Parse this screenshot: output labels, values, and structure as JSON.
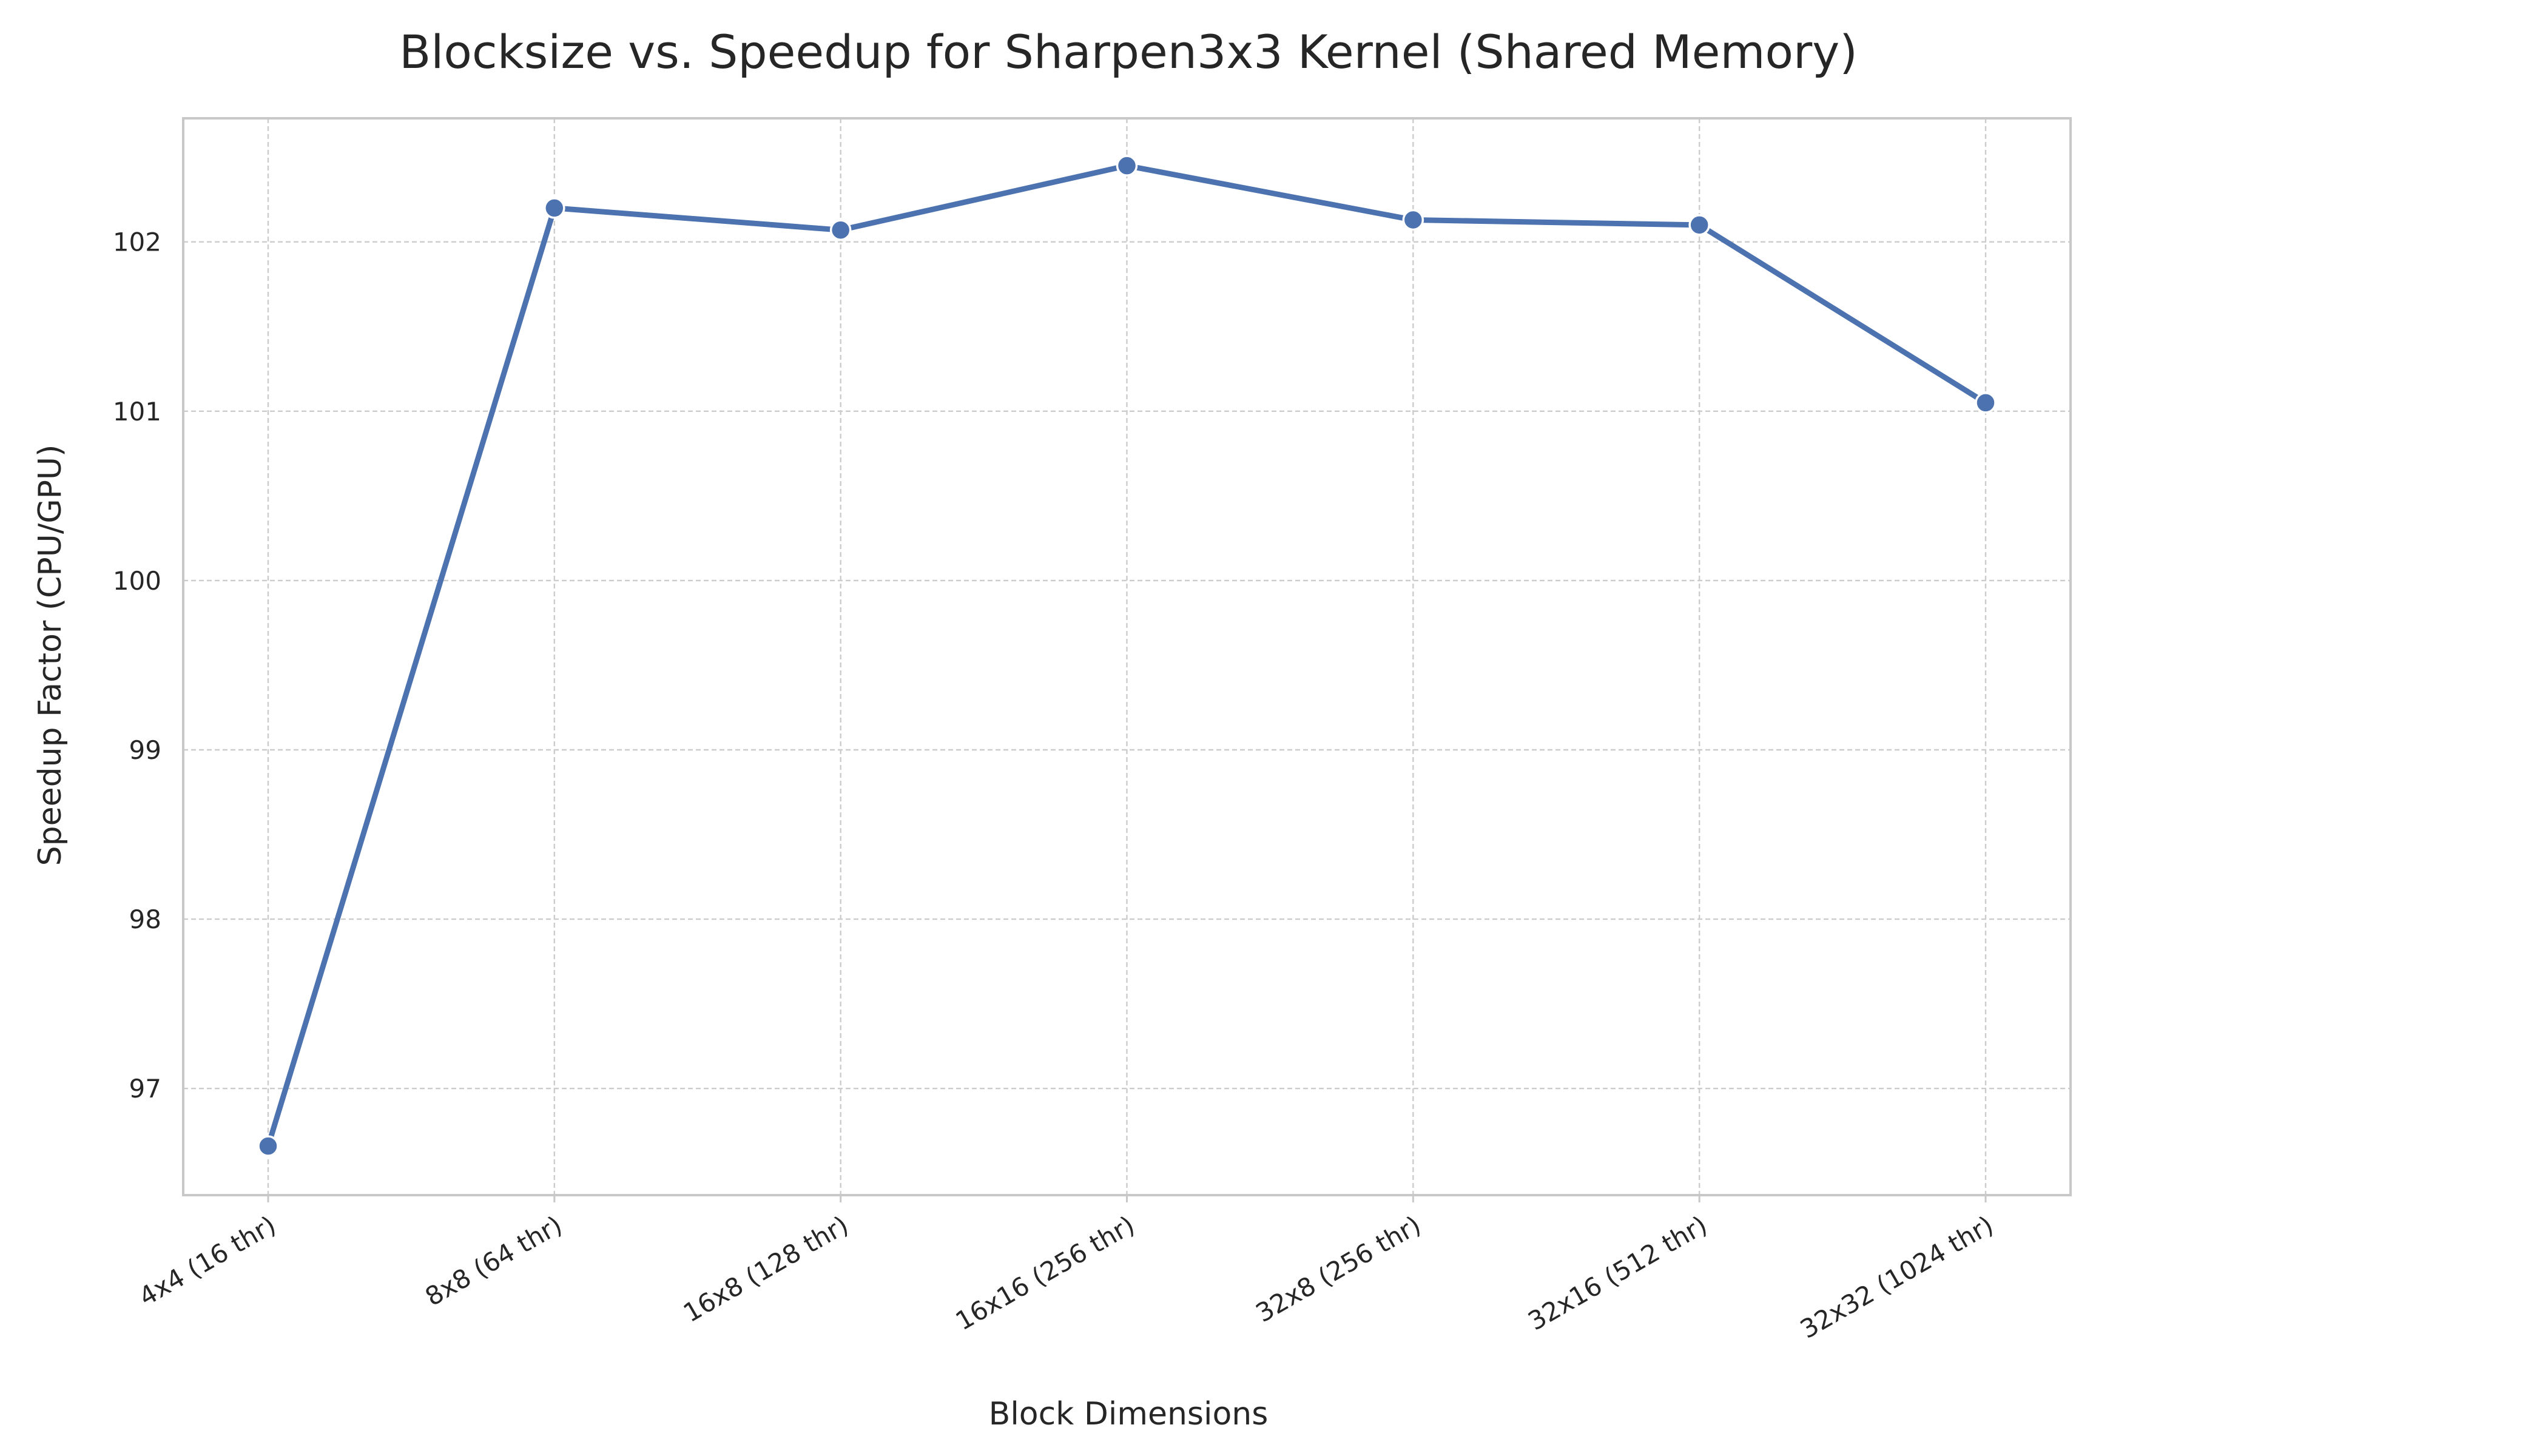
{
  "chart_data": {
    "type": "line",
    "title": "Blocksize vs. Speedup for Sharpen3x3 Kernel (Shared Memory)",
    "xlabel": "Block Dimensions",
    "ylabel": "Speedup Factor (CPU/GPU)",
    "categories": [
      "4x4 (16 thr)",
      "8x8 (64 thr)",
      "16x8 (128 thr)",
      "16x16 (256 thr)",
      "32x8 (256 thr)",
      "32x16 (512 thr)",
      "32x32 (1024 thr)"
    ],
    "series": [
      {
        "values": [
          96.66,
          102.2,
          102.07,
          102.45,
          102.13,
          102.1,
          101.05
        ]
      }
    ],
    "ylim": [
      96.37,
      102.73
    ],
    "yticks": [
      97,
      98,
      99,
      100,
      101,
      102
    ],
    "grid": true,
    "line_color": "#4c72b0",
    "marker_edge_color": "#ffffff"
  }
}
